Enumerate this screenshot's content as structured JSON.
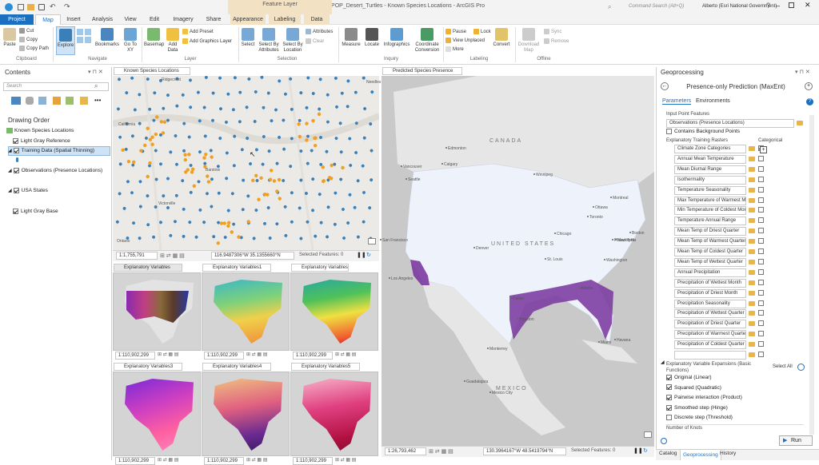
{
  "window": {
    "title": "POP_Desert_Turtles - Known Species Locations - ArcGIS Pro",
    "context_group": "Feature Layer",
    "search_placeholder": "Command Search (Alt+Q)",
    "user": "Alberto (Esri National Government)",
    "help": "?"
  },
  "tabs": [
    {
      "label": "Project"
    },
    {
      "label": "Map"
    },
    {
      "label": "Insert"
    },
    {
      "label": "Analysis"
    },
    {
      "label": "View"
    },
    {
      "label": "Edit"
    },
    {
      "label": "Imagery"
    },
    {
      "label": "Share"
    },
    {
      "label": "Appearance"
    },
    {
      "label": "Labeling"
    },
    {
      "label": "Data"
    }
  ],
  "ribbon": {
    "clipboard": {
      "paste": "Paste",
      "cut": "Cut",
      "copy": "Copy",
      "copy_path": "Copy Path",
      "group": "Clipboard"
    },
    "navigate": {
      "explore": "Explore",
      "bookmarks": "Bookmarks",
      "go_to_xy": "Go To XY",
      "group": "Navigate"
    },
    "layer": {
      "basemap": "Basemap",
      "add_data": "Add Data",
      "add_preset": "Add Preset",
      "add_graphics_layer": "Add Graphics Layer",
      "group": "Layer"
    },
    "selection": {
      "select": "Select",
      "select_by_attributes": "Select By Attributes",
      "select_by_location": "Select By Location",
      "attributes": "Attributes",
      "clear": "Clear",
      "group": "Selection"
    },
    "inquiry": {
      "measure": "Measure",
      "locate": "Locate",
      "infographics": "Infographics",
      "coordinate_conversion": "Coordinate Conversion",
      "group": "Inquiry"
    },
    "labeling": {
      "pause": "Pause",
      "lock": "Lock",
      "view_unplaced": "View Unplaced",
      "more": "More",
      "convert": "Convert",
      "group": "Labeling"
    },
    "offline": {
      "download_map": "Download Map",
      "sync": "Sync",
      "remove": "Remove",
      "group": "Offline"
    }
  },
  "contents": {
    "title": "Contents",
    "search_placeholder": "Search",
    "drawing_order": "Drawing Order",
    "layers": [
      {
        "label": "Known Species Locations",
        "checked": false
      },
      {
        "label": "Light Gray Reference",
        "checked": true
      },
      {
        "label": "Training Data (Spatial Thinning)",
        "checked": true
      },
      {
        "label": "Observations (Presence Locations)",
        "checked": true
      },
      {
        "label": "USA States",
        "checked": true
      },
      {
        "label": "Light Gray Base",
        "checked": true
      }
    ]
  },
  "maps": {
    "known": {
      "tab": "Known Species Locations",
      "scale": "1:1,755,791",
      "coords": "116.9487306°W 35.1355660°N",
      "selected": "Selected Features: 0",
      "places": [
        "Ridgecrest",
        "California",
        "Barstow",
        "Victorville",
        "Ontario",
        "Needles"
      ]
    },
    "presence": {
      "tab": "Predicted Species Presence",
      "scale": "1:26,793,462",
      "coords": "130.3964167°W 48.5419794°N",
      "selected": "Selected Features: 0",
      "countries": {
        "canada": "CANADA",
        "us": "UNITED STATES",
        "mexico": "MEXICO"
      },
      "cities": [
        "Edmonton",
        "Calgary",
        "Vancouver",
        "Seattle",
        "Winnipeg",
        "Montreal",
        "Ottawa",
        "Toronto",
        "Boston",
        "New York",
        "Chicago",
        "Philadelphia",
        "Washington",
        "Denver",
        "St. Louis",
        "San Francisco",
        "Los Angeles",
        "Dallas",
        "Houston",
        "Atlanta",
        "Miami",
        "Monterrey",
        "Guadalajara",
        "Mexico City",
        "Havana"
      ]
    },
    "explanatory": [
      {
        "tab": "Explanatory Variables",
        "scale": "1:110,902,299"
      },
      {
        "tab": "Explanatory Variables1",
        "scale": "1:110,902,299"
      },
      {
        "tab": "Explanatory Variables2",
        "scale": "1:110,902,299"
      },
      {
        "tab": "Explanatory Variables3",
        "scale": "1:110,902,299"
      },
      {
        "tab": "Explanatory Variables4",
        "scale": "1:110,902,299"
      },
      {
        "tab": "Explanatory Variables5",
        "scale": "1:110,902,299"
      }
    ]
  },
  "geoprocessing": {
    "title": "Geoprocessing",
    "tool": "Presence-only Prediction (MaxEnt)",
    "tabs": {
      "parameters": "Parameters",
      "environments": "Environments"
    },
    "input_label": "Input Point Features",
    "input_value": "Observations (Presence Locations)",
    "contains_background": "Contains Background Points",
    "rasters_label": "Explanatory Training Rasters",
    "categorical_label": "Categorical",
    "rasters": [
      {
        "name": "Climate Zone Categories",
        "categorical": true
      },
      {
        "name": "Annual Mean Temperature",
        "categorical": false
      },
      {
        "name": "Mean Diurnal Range",
        "categorical": false
      },
      {
        "name": "Isothermality",
        "categorical": false
      },
      {
        "name": "Temperature Seasonality",
        "categorical": false
      },
      {
        "name": "Max Temperature of Warmest Month",
        "categorical": false
      },
      {
        "name": "Min Temperature of Coldest Month",
        "categorical": false
      },
      {
        "name": "Temperature Annual Range",
        "categorical": false
      },
      {
        "name": "Mean Temp of Driest Quarter",
        "categorical": false
      },
      {
        "name": "Mean Temp of Warmest Quarter",
        "categorical": false
      },
      {
        "name": "Mean Temp of Coldest Quarter",
        "categorical": false
      },
      {
        "name": "Mean Temp of Wettest Quarter",
        "categorical": false
      },
      {
        "name": "Annual Precipitation",
        "categorical": false
      },
      {
        "name": "Precipitation of Wettest Month",
        "categorical": false
      },
      {
        "name": "Precipitation of Driest Month",
        "categorical": false
      },
      {
        "name": "Precipitation Seasonality",
        "categorical": false
      },
      {
        "name": "Precipitation of Wettest Quarter",
        "categorical": false
      },
      {
        "name": "Precipitation of Driest Quarter",
        "categorical": false
      },
      {
        "name": "Precipitation of Warmest Quarter",
        "categorical": false
      },
      {
        "name": "Precipitation of Coldest Quarter",
        "categorical": false
      },
      {
        "name": "",
        "categorical": false
      }
    ],
    "expansions_label": "Explanatory Variable Expansions (Basic Functions)",
    "select_all": "Select All",
    "expansions": [
      {
        "label": "Original (Linear)",
        "checked": true
      },
      {
        "label": "Squared (Quadratic)",
        "checked": true
      },
      {
        "label": "Pairwise interaction (Product)",
        "checked": true
      },
      {
        "label": "Smoothed step (Hinge)",
        "checked": true
      },
      {
        "label": "Discrete step (Threshold)",
        "checked": false
      }
    ],
    "knots_label": "Number of Knots",
    "run": "Run",
    "bottom_tabs": [
      "Catalog",
      "Geoprocessing",
      "History"
    ]
  },
  "colors": {
    "accent": "#1b6fc0",
    "presence": "#7b3aa0",
    "pin_blue": "#3a7fb8",
    "pin_orange": "#f0a020",
    "context_tab": "#f3e1c4"
  }
}
